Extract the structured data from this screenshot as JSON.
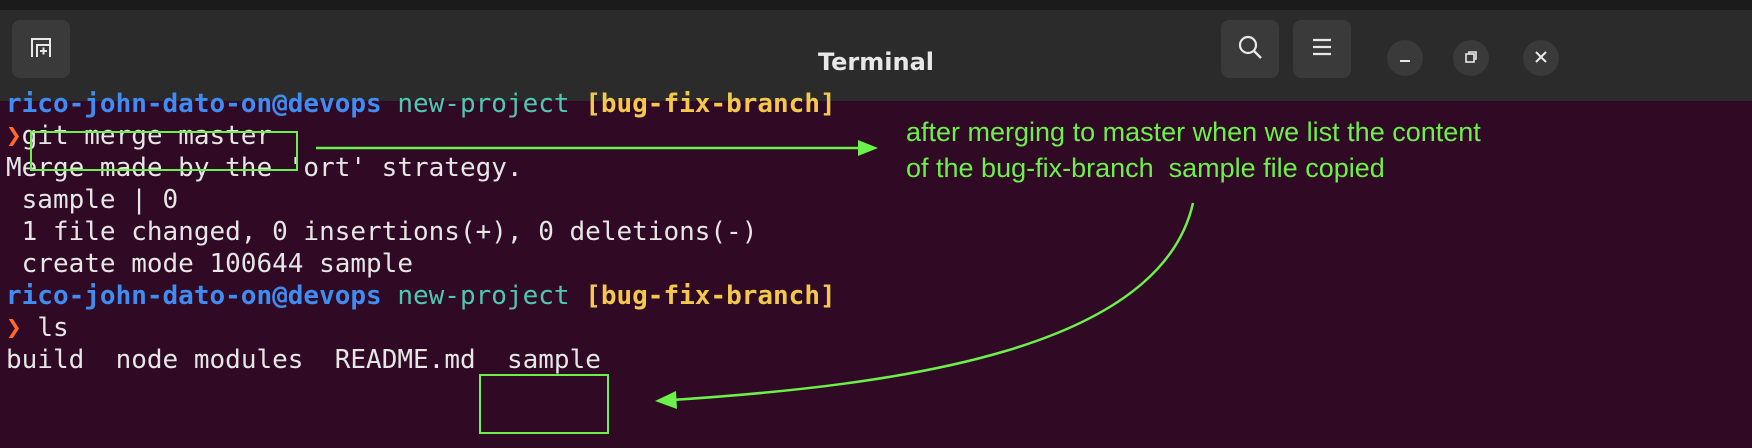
{
  "window": {
    "title": "Terminal",
    "icons": {
      "new_tab": "new-tab-icon",
      "search": "search-icon",
      "menu": "hamburger-menu-icon",
      "minimize": "minimize-icon",
      "maximize": "maximize-icon",
      "close": "close-icon"
    }
  },
  "terminal": {
    "prompt1": {
      "user": "rico-john-dato-on@devops",
      "dir": "new-project",
      "branch": "[bug-fix-branch]"
    },
    "caret": "❯",
    "cmd1": "git merge master",
    "out1": "Merge made by the 'ort' strategy.",
    "out2": " sample | 0",
    "out3": " 1 file changed, 0 insertions(+), 0 deletions(-)",
    "out4": " create mode 100644 sample",
    "prompt2": {
      "user": "rico-john-dato-on@devops",
      "dir": "new-project",
      "branch": "[bug-fix-branch]"
    },
    "cmd2": "ls",
    "ls_items": {
      "a": "build",
      "b": "node modules",
      "c": "README.md",
      "d": "sample"
    }
  },
  "annotation": {
    "line1": "after merging to master when we list the content",
    "line2": "of the bug-fix-branch  sample file copied",
    "color": "#6cf04a"
  }
}
